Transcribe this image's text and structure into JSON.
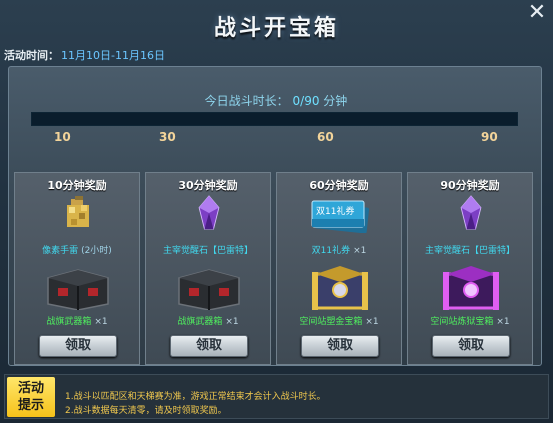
{
  "window": {
    "title": "战斗开宝箱",
    "close_glyph": "✕"
  },
  "event": {
    "label": "活动时间：",
    "dates": "11月10日-11月16日"
  },
  "progress": {
    "label": "今日战斗时长：",
    "current": "0",
    "max": "/90",
    "unit": "分钟",
    "fill_fraction": 0.0,
    "ticks": [
      "10",
      "30",
      "60",
      "90"
    ]
  },
  "rewards": [
    {
      "title": "10分钟奖励",
      "item1": {
        "name": "像素手雷",
        "suffix": "(2小时)",
        "icon": "pixel-grenade-icon"
      },
      "item2": {
        "name": "战旗武器箱",
        "qty": "×1",
        "icon": "weapon-crate-icon"
      },
      "button": "领取"
    },
    {
      "title": "30分钟奖励",
      "item1": {
        "name": "主宰觉醒石【巴雷特】",
        "icon": "purple-crystal-icon"
      },
      "item2": {
        "name": "战旗武器箱",
        "qty": "×1",
        "icon": "weapon-crate-icon"
      },
      "button": "领取"
    },
    {
      "title": "60分钟奖励",
      "item1": {
        "name": "双11礼券",
        "qty": "×1",
        "icon": "double11-coupon-icon",
        "card_text": "双11礼券"
      },
      "item2": {
        "name": "空间站塑金宝箱",
        "qty": "×1",
        "icon": "gold-chest-icon"
      },
      "button": "领取"
    },
    {
      "title": "90分钟奖励",
      "item1": {
        "name": "主宰觉醒石【巴雷特】",
        "icon": "purple-crystal-icon"
      },
      "item2": {
        "name": "空间站炼狱宝箱",
        "qty": "×1",
        "icon": "purple-chest-icon"
      },
      "button": "领取"
    }
  ],
  "tips": {
    "badge_line1": "活动",
    "badge_line2": "提示",
    "lines": [
      "1.战斗以匹配区和天梯赛为准，游戏正常结束才会计入战斗时长。",
      "2.战斗数据每天清零，请及时领取奖励。"
    ]
  },
  "colors": {
    "accent_cyan": "#41d9ef",
    "reward_green": "#4fef5e",
    "tip_yellow": "#f0c84e",
    "badge_yellow": "#f6c21a",
    "tick_gold": "#f3d49a"
  }
}
